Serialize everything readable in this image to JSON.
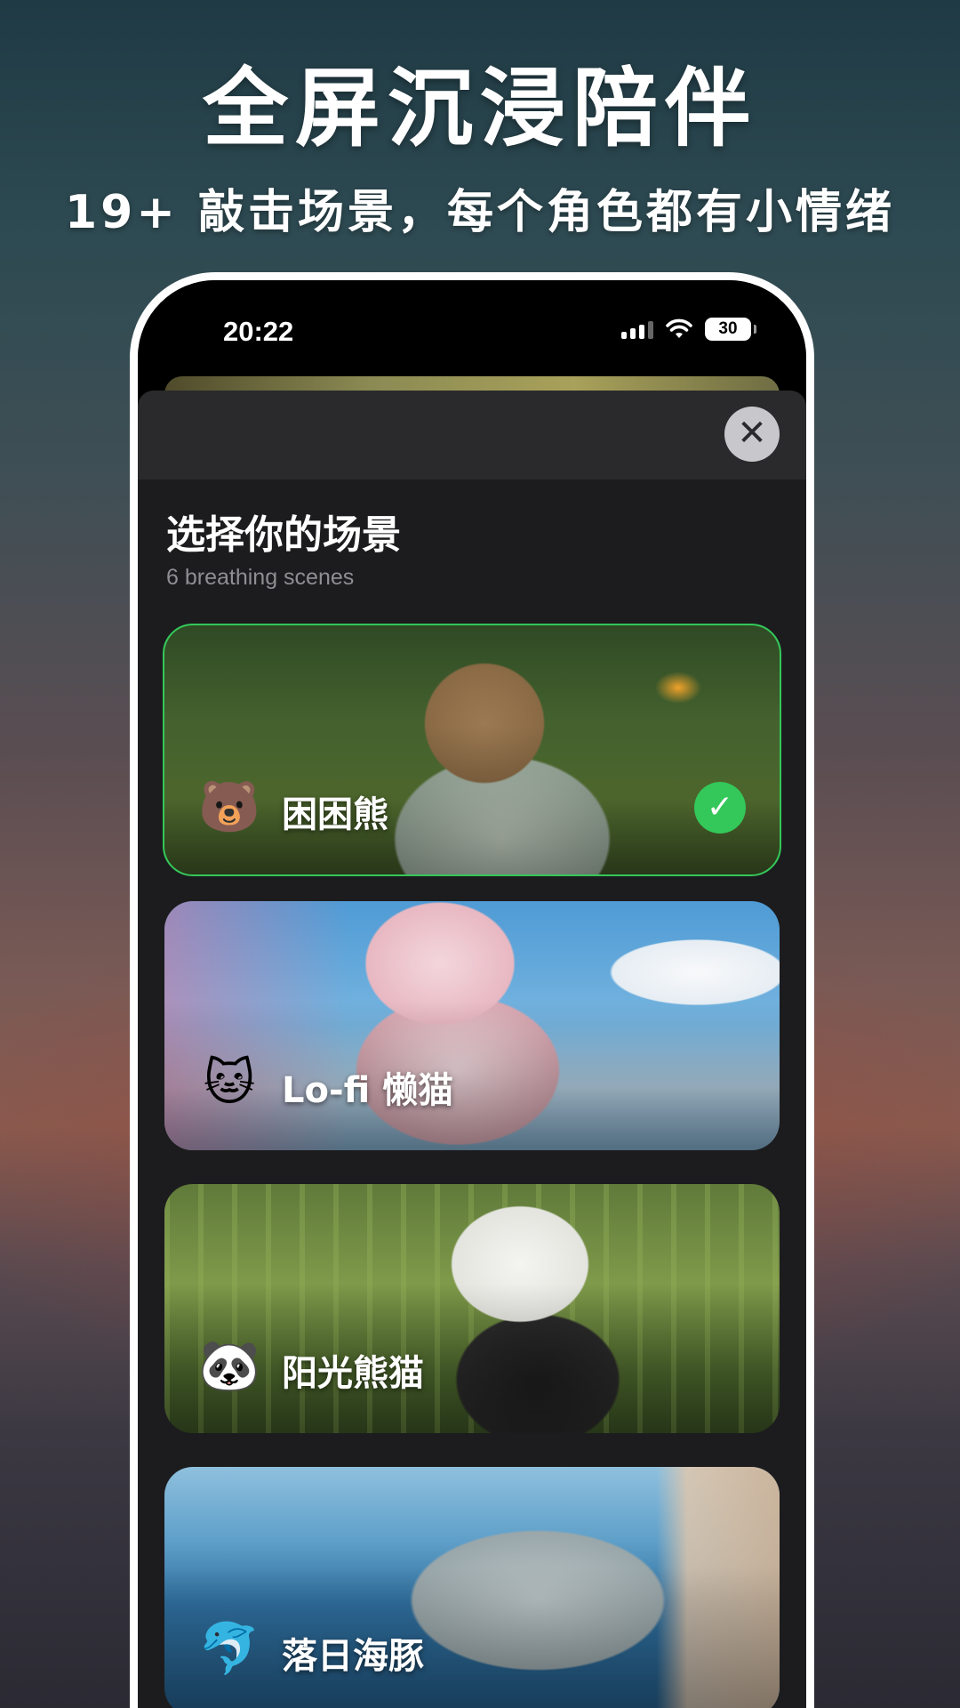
{
  "promo": {
    "headline": "全屏沉浸陪伴",
    "subline": "19+ 敲击场景，每个角色都有小情绪"
  },
  "statusbar": {
    "time": "20:22",
    "battery": "30",
    "icons": [
      "cellular-signal-icon",
      "wifi-icon",
      "battery-icon"
    ]
  },
  "sheet": {
    "close_icon": "close-icon",
    "title": "选择你的场景",
    "subtitle": "6 breathing scenes",
    "scenes": [
      {
        "emoji": "🐻",
        "label": "困困熊",
        "selected": true
      },
      {
        "emoji": "🐱",
        "label": "Lo-fi 懒猫",
        "selected": false
      },
      {
        "emoji": "🐼",
        "label": "阳光熊猫",
        "selected": false
      },
      {
        "emoji": "🐬",
        "label": "落日海豚",
        "selected": false
      }
    ]
  },
  "colors": {
    "selected_accent": "#34c759",
    "sheet_background": "#1c1c1e",
    "subtitle_gray": "#8e8e93"
  }
}
